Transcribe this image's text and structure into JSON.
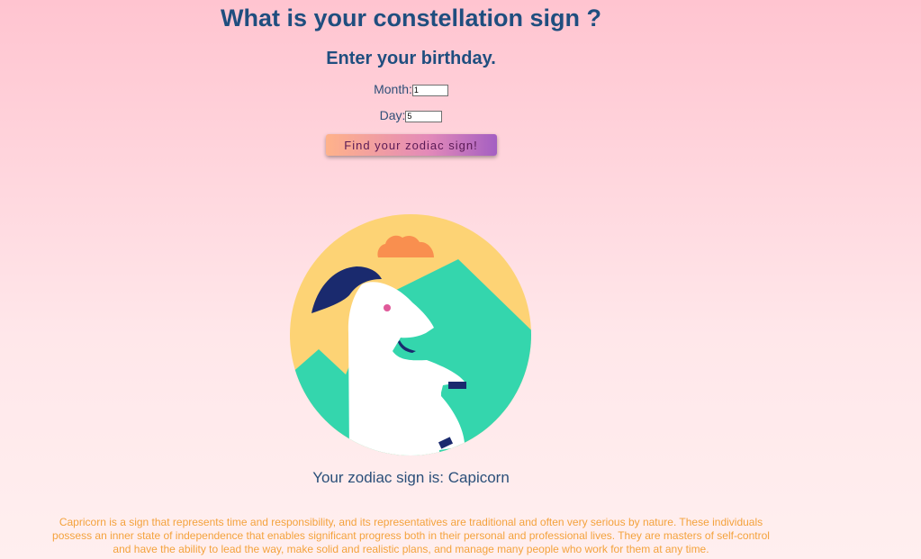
{
  "header": {
    "title": "What is your constellation sign ?",
    "subtitle": "Enter your birthday."
  },
  "form": {
    "month_label": "Month:",
    "month_value": "1",
    "day_label": "Day:",
    "day_value": "5",
    "submit_label": "Find your zodiac sign!"
  },
  "result": {
    "image_icon": "capricorn-goat-icon",
    "text": "Your zodiac sign is: Capicorn",
    "description": "Capricorn is a sign that represents time and responsibility, and its representatives are traditional and often very serious by nature. These individuals possess an inner state of independence that enables significant progress both in their personal and professional lives. They are masters of self-control and have the ability to lead the way, make solid and realistic plans, and manage many people who work for them at any time."
  },
  "colors": {
    "heading": "#1f4e7f",
    "description": "#f4a23c",
    "circle_bg": "#fdd375",
    "mountain": "#34d6ad",
    "horn": "#1a2a6e",
    "cloud": "#f98f4f",
    "goat": "#ffffff",
    "eye": "#e05a9a"
  }
}
